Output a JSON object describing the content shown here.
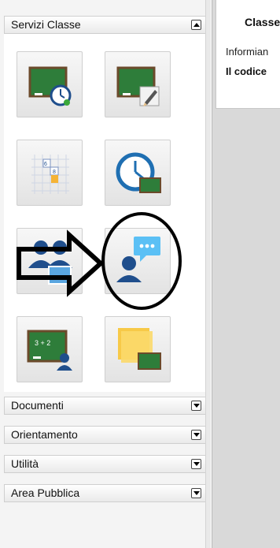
{
  "sidebar": {
    "sections": [
      {
        "label": "Servizi Classe",
        "expanded": true
      },
      {
        "label": "Documenti",
        "expanded": false
      },
      {
        "label": "Orientamento",
        "expanded": false
      },
      {
        "label": "Utilità",
        "expanded": false
      },
      {
        "label": "Area Pubblica",
        "expanded": false
      }
    ],
    "tiles": [
      {
        "icon": "classroom-board-clock-icon"
      },
      {
        "icon": "classroom-board-edit-icon"
      },
      {
        "icon": "calendar-grid-icon"
      },
      {
        "icon": "clock-board-icon"
      },
      {
        "icon": "teachers-group-icon"
      },
      {
        "icon": "user-chat-bubble-icon"
      },
      {
        "icon": "board-math-teacher-icon"
      },
      {
        "icon": "sticky-note-board-icon"
      }
    ]
  },
  "content": {
    "title": "Classe",
    "line1": "Informian",
    "line2": "Il codice"
  },
  "colors": {
    "board_green": "#2e7d3a",
    "blue_accent": "#1f6fb2",
    "chat_blue": "#5bc0f5"
  }
}
